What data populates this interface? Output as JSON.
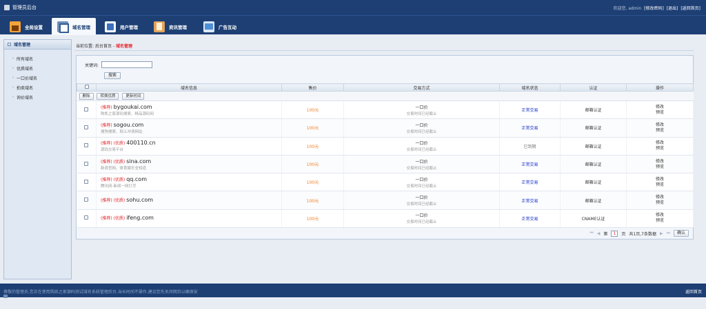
{
  "topbar": {
    "title": "管理员后台",
    "welcome": "欢迎您,",
    "user": "admin",
    "change_password": "[修改密码]",
    "logout": "[退出]",
    "home": "[返回首页]"
  },
  "nav": {
    "tabs": [
      {
        "label": "全局设置",
        "icon": "home-icon"
      },
      {
        "label": "域名管理",
        "icon": "domain-icon",
        "active": true
      },
      {
        "label": "用户管理",
        "icon": "user-icon"
      },
      {
        "label": "资讯管理",
        "icon": "news-icon"
      },
      {
        "label": "广告互动",
        "icon": "ad-icon"
      }
    ]
  },
  "sidebar": {
    "title": "域名管理",
    "items": [
      {
        "label": "所有域名"
      },
      {
        "label": "优质域名"
      },
      {
        "label": "一口价域名"
      },
      {
        "label": "拍卖域名"
      },
      {
        "label": "询价域名"
      }
    ]
  },
  "breadcrumb": {
    "prefix": "当前位置:",
    "home": "后台首页",
    "sep": " - ",
    "current": "域名管理"
  },
  "search": {
    "label": "关键词:",
    "value": "",
    "button": "搜索"
  },
  "table": {
    "headers": [
      "域名信息",
      "售价",
      "交易方式",
      "域名状态",
      "认证",
      "操作"
    ],
    "toolbar": [
      "删除",
      "转换优质",
      "更新时间"
    ],
    "rows": [
      {
        "tags": "(推荐)",
        "domain": "bygoukai.com",
        "desc": "购凯之家源码搜索、精品源码网",
        "price": "100元",
        "trade": "一口价",
        "trade_note": "交易时间已经截止",
        "status": "正常交易",
        "status_type": "ok",
        "cert": "邮箱认证",
        "op1": "修改",
        "op2": "预览"
      },
      {
        "tags": "(推荐)",
        "domain": "sogou.com",
        "desc": "搜狗搜索、网上冲浪网站",
        "price": "100元",
        "trade": "一口价",
        "trade_note": "交易时间已经截止",
        "status": "正常交易",
        "status_type": "ok",
        "cert": "邮箱认证",
        "op1": "修改",
        "op2": "预览"
      },
      {
        "tags": "(推荐) (优质)",
        "domain": "400110.cn",
        "desc": "源码交易平台",
        "price": "100元",
        "trade": "一口价",
        "trade_note": "交易时间已经截止",
        "status": "已到期",
        "status_type": "expired",
        "cert": "邮箱认证",
        "op1": "修改",
        "op2": "预览"
      },
      {
        "tags": "(推荐) (优质)",
        "domain": "sina.com",
        "desc": "新浪官网、体育娱乐全知道",
        "price": "100元",
        "trade": "一口价",
        "trade_note": "交易时间已经截止",
        "status": "正常交易",
        "status_type": "ok",
        "cert": "邮箱认证",
        "op1": "修改",
        "op2": "预览"
      },
      {
        "tags": "(推荐) (优质)",
        "domain": "qq.com",
        "desc": "腾讯网-新闻一网打尽",
        "price": "100元",
        "trade": "一口价",
        "trade_note": "交易时间已经截止",
        "status": "正常交易",
        "status_type": "ok",
        "cert": "邮箱认证",
        "op1": "修改",
        "op2": "预览"
      },
      {
        "tags": "(推荐) (优质)",
        "domain": "sohu.com",
        "desc": "",
        "price": "100元",
        "trade": "一口价",
        "trade_note": "交易时间已经截止",
        "status": "正常交易",
        "status_type": "ok",
        "cert": "邮箱认证",
        "op1": "修改",
        "op2": "预览"
      },
      {
        "tags": "(推荐) (优质)",
        "domain": "ifeng.com",
        "desc": "",
        "price": "100元",
        "trade": "一口价",
        "trade_note": "交易时间已经截止",
        "status": "正常交易",
        "status_type": "ok",
        "cert": "CNAME认证",
        "op1": "修改",
        "op2": "预览"
      }
    ]
  },
  "pager": {
    "first": "⏮",
    "prev": "◀",
    "page_prefix": "第",
    "page": "1",
    "page_suffix": "页",
    "total": "共1页,7条数据",
    "next": "▶",
    "last": "⏭",
    "confirm": "确认"
  },
  "footer": {
    "notice": "尊敬的管理员,您正在使用购凯之家源码测试域名系统管理后台,当长时间不操作,建议您先关闭网页以确保安",
    "home": "返回首页"
  }
}
